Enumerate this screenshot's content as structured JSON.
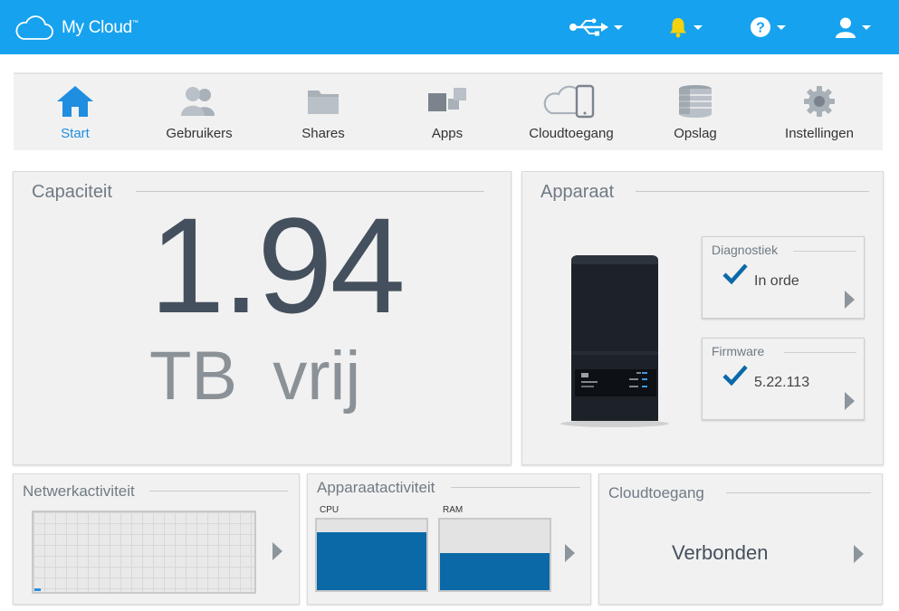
{
  "header": {
    "logo_text": "My Cloud",
    "logo_tm": "™",
    "icons": [
      "usb-icon",
      "bell-icon",
      "help-icon",
      "user-icon"
    ],
    "accent_color": "#16a2ee",
    "bell_color": "#f5d20e"
  },
  "nav": {
    "items": [
      {
        "label": "Start",
        "icon": "home-icon",
        "active": true
      },
      {
        "label": "Gebruikers",
        "icon": "users-icon"
      },
      {
        "label": "Shares",
        "icon": "folder-icon"
      },
      {
        "label": "Apps",
        "icon": "apps-icon"
      },
      {
        "label": "Cloudtoegang",
        "icon": "cloud-device-icon"
      },
      {
        "label": "Opslag",
        "icon": "storage-icon"
      },
      {
        "label": "Instellingen",
        "icon": "gear-icon"
      }
    ]
  },
  "capacity": {
    "title": "Capaciteit",
    "value": "1.94",
    "unit": "TB vrij"
  },
  "device": {
    "title": "Apparaat",
    "diagnostics": {
      "title": "Diagnostiek",
      "value": "In orde"
    },
    "firmware": {
      "title": "Firmware",
      "value": "5.22.113"
    }
  },
  "network": {
    "title": "Netwerkactiviteit"
  },
  "activity": {
    "title": "Apparaatactiviteit",
    "cpu": {
      "label": "CPU",
      "fraction": 0.82
    },
    "ram": {
      "label": "RAM",
      "fraction": 0.53
    }
  },
  "cloud": {
    "title": "Cloudtoegang",
    "status": "Verbonden"
  }
}
